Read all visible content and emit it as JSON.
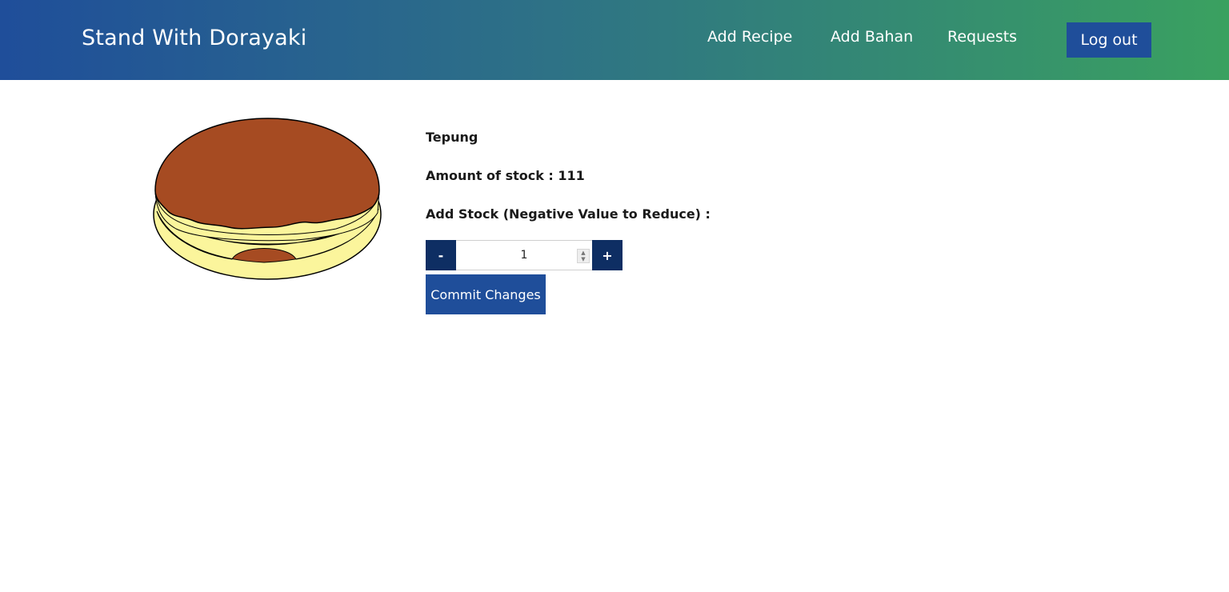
{
  "header": {
    "brand": "Stand With Dorayaki",
    "nav": {
      "add_recipe": "Add Recipe",
      "add_bahan": "Add Bahan",
      "requests": "Requests"
    },
    "logout_label": "Log out"
  },
  "ingredient": {
    "name": "Tepung",
    "stock_text": "Amount of stock : 111",
    "add_stock_label": "Add Stock (Negative Value to Reduce) :"
  },
  "stepper": {
    "minus_label": "-",
    "plus_label": "+",
    "value": "1"
  },
  "commit_label": "Commit Changes",
  "colors": {
    "header_gradient_start": "#1f4e9a",
    "header_gradient_end": "#3aa160",
    "primary_button": "#1f4e9a",
    "stepper_button": "#0e2e63"
  },
  "icons": {
    "dorayaki": "dorayaki-illustration"
  }
}
